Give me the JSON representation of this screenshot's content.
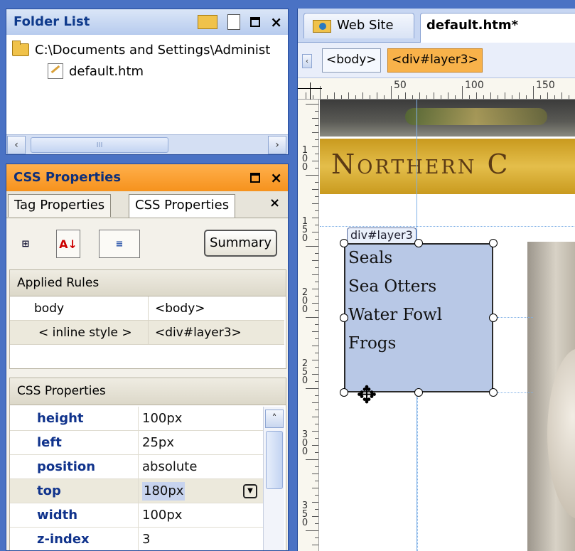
{
  "folder_list": {
    "title": "Folder List",
    "path": "C:\\Documents and Settings\\Administ",
    "file": "default.htm",
    "scroll_thumb": "III"
  },
  "css_panel": {
    "title": "CSS Properties",
    "tabs": [
      "Tag Properties",
      "CSS Properties"
    ],
    "summary_label": "Summary",
    "applied_rules_header": "Applied Rules",
    "rules": [
      {
        "selector": "body",
        "tag": "<body>"
      },
      {
        "selector": "< inline style >",
        "tag": "<div#layer3>"
      }
    ],
    "properties_header": "CSS Properties",
    "properties": [
      {
        "name": "height",
        "value": "100px"
      },
      {
        "name": "left",
        "value": "25px"
      },
      {
        "name": "position",
        "value": "absolute"
      },
      {
        "name": "top",
        "value": "180px"
      },
      {
        "name": "width",
        "value": "100px"
      },
      {
        "name": "z-index",
        "value": "3"
      }
    ]
  },
  "document": {
    "tabs": [
      "Web Site",
      "default.htm*"
    ],
    "tag_selector": [
      "<body>",
      "<div#layer3>"
    ],
    "ruler_marks": [
      "50",
      "100",
      "150"
    ],
    "vruler_marks": [
      "100",
      "150",
      "200",
      "250",
      "300",
      "350"
    ],
    "banner_text": "Northern C",
    "layer_label": "div#layer3",
    "layer_items": [
      "Seals",
      "Sea Otters",
      "Water Fowl",
      "Frogs"
    ]
  },
  "colors": {
    "frame": "#4a72c4",
    "active_panel": "#f6921d",
    "layer_fill": "#b8c8e6",
    "selected_tag": "#f8b24a",
    "banner": "#d9ad2f"
  }
}
